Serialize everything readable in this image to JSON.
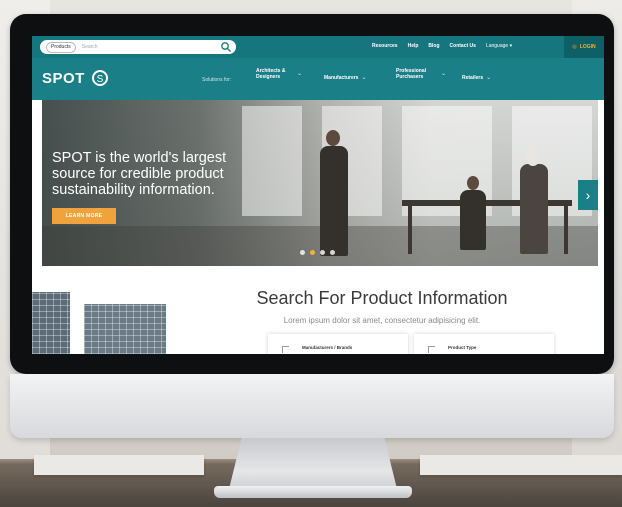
{
  "topbar": {
    "product_chip": "Products",
    "search_placeholder": "Search",
    "links": [
      "Resources",
      "Help",
      "Blog",
      "Contact Us"
    ],
    "language": "Language",
    "login": "LOGIN"
  },
  "nav": {
    "logo": "SPOT",
    "solutions_label": "Solutions for:",
    "items": [
      "Architects & Designers",
      "Manufacturers",
      "Professional Purchasers",
      "Retailers"
    ]
  },
  "hero": {
    "headline": "SPOT is the world's largest source for credible product sustainability information.",
    "cta": "LEARN MORE",
    "slides_count": 4,
    "active_slide": 1
  },
  "search_section": {
    "title": "Search For Product Information",
    "subtitle": "Lorem ipsum dolor sit amet, consectetur adipisicing elit.",
    "cards": [
      "Manufacturers / Brands",
      "Product Type"
    ]
  },
  "icons": [
    "search-icon",
    "chevron-down-icon",
    "chevron-right-icon",
    "login-icon",
    "logo-mark-icon"
  ],
  "colors": {
    "teal": "#1b7f87",
    "teal_dark": "#16767e",
    "accent": "#f0a23c"
  }
}
